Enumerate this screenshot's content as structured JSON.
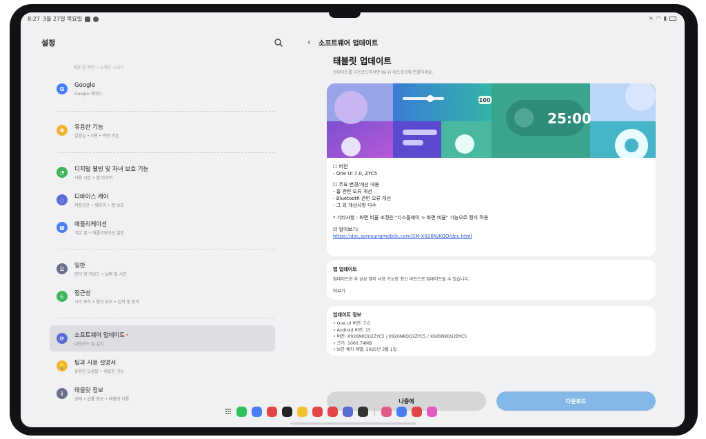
{
  "status": {
    "time": "8:27",
    "date": "3월 27일 목요일"
  },
  "settings": {
    "title": "설정",
    "prev_subtitle": "계정 및 백업 • 스마트 스위치",
    "items": [
      {
        "title": "Google",
        "sub": "Google 서비스",
        "color": "#4a7df2",
        "icon": "G"
      },
      {
        "title": "유용한 기능",
        "sub": "실험실 • S펜 • 측면 버튼",
        "color": "#f2b332",
        "icon": "✱"
      },
      {
        "title": "디지털 웰빙 및 자녀 보호 기능",
        "sub": "사용 시간 • 앱 타이머",
        "color": "#3fb45c",
        "icon": "◔"
      },
      {
        "title": "디바이스 케어",
        "sub": "저장공간 • 메모리 • 앱 보호",
        "color": "#5b6bd6",
        "icon": "◌"
      },
      {
        "title": "애플리케이션",
        "sub": "기본 앱 • 애플리케이션 설정",
        "color": "#4a7df2",
        "icon": "▦"
      },
      {
        "title": "일반",
        "sub": "언어 및 키보드 • 날짜 및 시간",
        "color": "#6b6f8a",
        "icon": "☰"
      },
      {
        "title": "접근성",
        "sub": "시각 보조 • 청각 보조 • 입력 및 동작",
        "color": "#3fb45c",
        "icon": "♿"
      },
      {
        "title": "소프트웨어 업데이트",
        "sub": "다운로드 및 설치",
        "color": "#5b6bd6",
        "icon": "⟳",
        "badge": "•"
      },
      {
        "title": "팁과 사용 설명서",
        "sub": "유용한 도움말 • 새로운 기능",
        "color": "#f2b332",
        "icon": "💡"
      },
      {
        "title": "태블릿 정보",
        "sub": "상태 • 법률 정보 • 태블릿 이름",
        "color": "#6b6f8a",
        "icon": "i"
      }
    ]
  },
  "update": {
    "header": "소프트웨어 업데이트",
    "title": "태블릿 업데이트",
    "wifi_note": "업데이트를 다운로드하려면 Wi-Fi 네트워크에 연결하세요.",
    "banner_timer": "25:00",
    "banner_battery": "100",
    "details": {
      "version_header": "☐ 버전",
      "version_value": "- One UI 7.0, ZYC5",
      "changes_header": "☐ 주요 변경/개선 내용",
      "change_1": "- 홈 관련 오류 개선",
      "change_2": "- Bluetooth 관련 오류 개선",
      "change_3": "- 그 외 개선사항 다수",
      "note": "* 기타사항 : 화면 비율 조정은 \"디스플레이 > 화면 비율\" 기능으로 정식 적용",
      "more_label": "더 알아보기:",
      "more_link": "https://doc.samsungmobile.com/SM-X926N/KOO/doc.html"
    },
    "app_update": {
      "title": "앱 업데이트",
      "desc": "업데이트한 후 삼성 앱이 사용 가능한 최신 버전으로 업데이트될 수 있습니다.",
      "more": "더보기"
    },
    "info": {
      "title": "업데이트 정보",
      "lines": [
        "• One UI 버전: 7.0",
        "• Android 버전: 15",
        "• 버전: X926NKOU2ZYC5 / X926NKOO2ZYC5 / X926NKOU2BYC5",
        "• 크기: 1066.74MB",
        "• 보안 패치 레벨: 2025년 3월 1일"
      ]
    },
    "later_button": "나중에",
    "download_button": "다운로드"
  },
  "dock": {
    "colors": [
      "#2fbf5b",
      "#4a7df2",
      "#e24545",
      "#222222",
      "#f2c233",
      "#e24545",
      "#e24545",
      "#5b6bd6",
      "#333333",
      "#e25a8a",
      "#4a7df2",
      "#e24545",
      "#e25ac0"
    ]
  }
}
